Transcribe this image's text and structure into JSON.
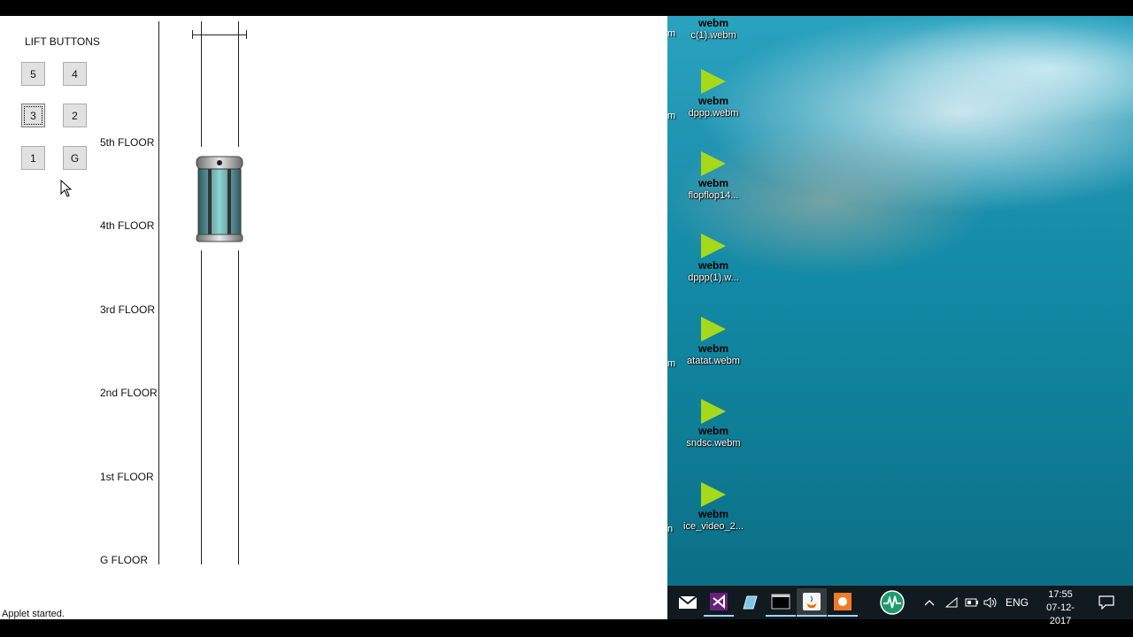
{
  "applet": {
    "title": "LIFT BUTTONS",
    "buttons": [
      "5",
      "4",
      "3",
      "2",
      "1",
      "G"
    ],
    "focused_button": "3",
    "floors": [
      "5th FLOOR",
      "4th FLOOR",
      "3rd FLOOR",
      "2nd FLOOR",
      "1st FLOOR",
      "G FLOOR"
    ],
    "status": "Applet started."
  },
  "desktop": {
    "icons": [
      {
        "name": "c(1).webm",
        "badge": "webm",
        "edge": "m"
      },
      {
        "name": "dppp.webm",
        "badge": "webm",
        "edge": "m"
      },
      {
        "name": "flopflop14...",
        "badge": "webm",
        "edge": ""
      },
      {
        "name": "dppp(1).w...",
        "badge": "webm",
        "edge": ""
      },
      {
        "name": "atatat.webm",
        "badge": "webm",
        "edge": "m"
      },
      {
        "name": "sndsc.webm",
        "badge": "webm",
        "edge": ""
      },
      {
        "name": "ice_video_2...",
        "badge": "webm",
        "edge": "n"
      }
    ]
  },
  "taskbar": {
    "apps": [
      "mail-icon",
      "visual-studio-icon",
      "notepad-icon",
      "terminal-icon",
      "java-icon",
      "media-icon",
      "activity-monitor-icon"
    ],
    "language": "ENG",
    "time": "17:55",
    "date": "07-12-2017"
  },
  "colors": {
    "accent_green": "#a6d91a",
    "taskbar": "#111a1f"
  }
}
